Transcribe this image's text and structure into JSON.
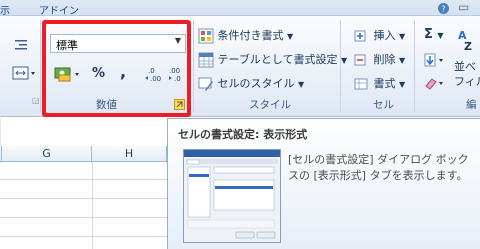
{
  "tabs": [
    "示",
    "アドイン"
  ],
  "number_group": {
    "format_value": "標準",
    "percent_label": "%",
    "comma_label": ",",
    "decimal_inc": ".0 .00",
    "decimal_dec": ".00 .0",
    "label": "数値"
  },
  "styles_group": {
    "conditional": "条件付き書式",
    "as_table": "テーブルとして書式設定",
    "cell_styles": "セルのスタイル",
    "label": "スタイル"
  },
  "cells_group": {
    "insert": "挿入",
    "delete": "削除",
    "format": "書式",
    "label": "セル"
  },
  "editing_group": {
    "sigma": "Σ",
    "sort_line1": "並べ",
    "sort_line2": "フィル",
    "label": "編"
  },
  "sheet": {
    "columns": [
      "G",
      "H"
    ]
  },
  "tooltip": {
    "title": "セルの書式設定: 表示形式",
    "body": "[セルの書式設定] ダイアログ ボックスの [表示形式] タブを表示します。"
  }
}
